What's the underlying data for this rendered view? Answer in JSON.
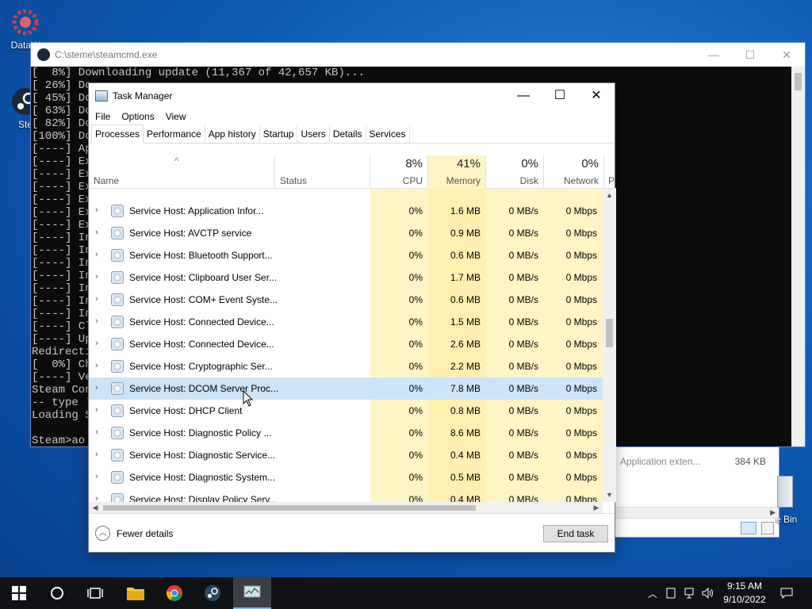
{
  "desktop": {
    "icons": [
      {
        "label": "DataW"
      },
      {
        "label": "Ste"
      }
    ],
    "recycle_bin_label": "e Bin"
  },
  "explorer_bg": {
    "rows": [
      {
        "name": "Application exten...",
        "size": "384 KB"
      }
    ]
  },
  "console": {
    "title": "C:\\steme\\steamcmd.exe",
    "lines": [
      "[  8%] Downloading update (11,367 of 42,657 KB)...",
      "[ 26%] Do",
      "[ 45%] Do",
      "[ 63%] Do",
      "[ 82%] Do",
      "[100%] Do",
      "[----] Ap",
      "[----] Ex",
      "[----] Ex",
      "[----] Ex",
      "[----] Ex",
      "[----] Ex",
      "[----] Ex",
      "[----] In",
      "[----] In",
      "[----] In",
      "[----] In",
      "[----] In",
      "[----] In",
      "[----] In",
      "[----] Cl",
      "[----] Up",
      "Redirecti",
      "[  0%] Ch",
      "[----] Ve",
      "Steam Con",
      "-- type '",
      "Loading S",
      "",
      "Steam>ao"
    ]
  },
  "taskmanager": {
    "title": "Task Manager",
    "menu": [
      "File",
      "Options",
      "View"
    ],
    "tabs": [
      "Processes",
      "Performance",
      "App history",
      "Startup",
      "Users",
      "Details",
      "Services"
    ],
    "columns": {
      "name": "Name",
      "status": "Status",
      "cpu": {
        "pct": "8%",
        "label": "CPU"
      },
      "memory": {
        "pct": "41%",
        "label": "Memory"
      },
      "disk": {
        "pct": "0%",
        "label": "Disk"
      },
      "network": {
        "pct": "0%",
        "label": "Network"
      },
      "power": "P"
    },
    "rows": [
      {
        "name": "Service Host: Application Infor...",
        "cpu": "0%",
        "mem": "1.6 MB",
        "disk": "0 MB/s",
        "net": "0 Mbps"
      },
      {
        "name": "Service Host: AVCTP service",
        "cpu": "0%",
        "mem": "0.9 MB",
        "disk": "0 MB/s",
        "net": "0 Mbps"
      },
      {
        "name": "Service Host: Bluetooth Support...",
        "cpu": "0%",
        "mem": "0.6 MB",
        "disk": "0 MB/s",
        "net": "0 Mbps"
      },
      {
        "name": "Service Host: Clipboard User Ser...",
        "cpu": "0%",
        "mem": "1.7 MB",
        "disk": "0 MB/s",
        "net": "0 Mbps"
      },
      {
        "name": "Service Host: COM+ Event Syste...",
        "cpu": "0%",
        "mem": "0.6 MB",
        "disk": "0 MB/s",
        "net": "0 Mbps"
      },
      {
        "name": "Service Host: Connected Device...",
        "cpu": "0%",
        "mem": "1.5 MB",
        "disk": "0 MB/s",
        "net": "0 Mbps"
      },
      {
        "name": "Service Host: Connected Device...",
        "cpu": "0%",
        "mem": "2.6 MB",
        "disk": "0 MB/s",
        "net": "0 Mbps"
      },
      {
        "name": "Service Host: Cryptographic Ser...",
        "cpu": "0%",
        "mem": "2.2 MB",
        "disk": "0 MB/s",
        "net": "0 Mbps"
      },
      {
        "name": "Service Host: DCOM Server Proc...",
        "cpu": "0%",
        "mem": "7.8 MB",
        "disk": "0 MB/s",
        "net": "0 Mbps",
        "selected": true
      },
      {
        "name": "Service Host: DHCP Client",
        "cpu": "0%",
        "mem": "0.8 MB",
        "disk": "0 MB/s",
        "net": "0 Mbps"
      },
      {
        "name": "Service Host: Diagnostic Policy ...",
        "cpu": "0%",
        "mem": "8.6 MB",
        "disk": "0 MB/s",
        "net": "0 Mbps"
      },
      {
        "name": "Service Host: Diagnostic Service...",
        "cpu": "0%",
        "mem": "0.4 MB",
        "disk": "0 MB/s",
        "net": "0 Mbps"
      },
      {
        "name": "Service Host: Diagnostic System...",
        "cpu": "0%",
        "mem": "0.5 MB",
        "disk": "0 MB/s",
        "net": "0 Mbps"
      },
      {
        "name": "Service Host: Display Policy Serv...",
        "cpu": "0%",
        "mem": "0.4 MB",
        "disk": "0 MB/s",
        "net": "0 Mbps"
      }
    ],
    "fewer_details": "Fewer details",
    "end_task": "End task"
  },
  "taskbar": {
    "time": "9:15 AM",
    "date": "9/10/2022"
  }
}
